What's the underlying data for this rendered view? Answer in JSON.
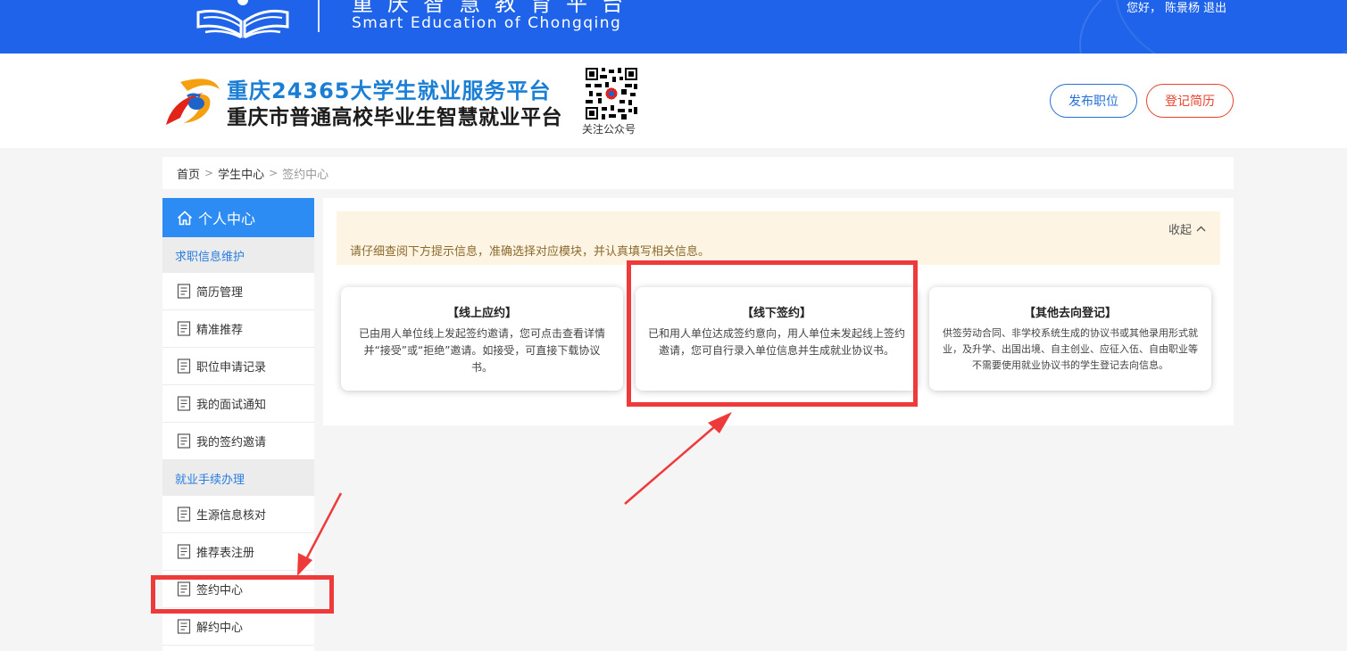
{
  "topbar": {
    "cn_title": "重庆智慧教育平台",
    "en_title": "Smart Education of Chongqing",
    "greeting": "您好，",
    "username": "陈景杨",
    "logout": "退出"
  },
  "header": {
    "brand_line1": "重庆24365大学生就业服务平台",
    "brand_line2": "重庆市普通高校毕业生智慧就业平台",
    "qr_caption": "关注公众号",
    "post_job": "发布职位",
    "register_resume": "登记简历"
  },
  "breadcrumb": {
    "home": "首页",
    "student_center": "学生中心",
    "current": "签约中心"
  },
  "sidebar": {
    "title": "个人中心",
    "group1": "求职信息维护",
    "group1_items": [
      {
        "label": "简历管理"
      },
      {
        "label": "精准推荐"
      },
      {
        "label": "职位申请记录"
      },
      {
        "label": "我的面试通知"
      },
      {
        "label": "我的签约邀请"
      }
    ],
    "group2": "就业手续办理",
    "group2_items": [
      {
        "label": "生源信息核对"
      },
      {
        "label": "推荐表注册"
      },
      {
        "label": "签约中心"
      },
      {
        "label": "解约中心"
      }
    ]
  },
  "notice": {
    "text": "请仔细查阅下方提示信息，准确选择对应模块，并认真填写相关信息。",
    "collapse": "收起"
  },
  "cards": [
    {
      "title": "【线上应约】",
      "desc": "已由用人单位线上发起签约邀请，您可点击查看详情并“接受”或“拒绝”邀请。如接受，可直接下载协议书。"
    },
    {
      "title": "【线下签约】",
      "desc": "已和用人单位达成签约意向，用人单位未发起线上签约邀请，您可自行录入单位信息并生成就业协议书。"
    },
    {
      "title": "【其他去向登记】",
      "desc": "供签劳动合同、非学校系统生成的协议书或其他录用形式就业，及升学、出国出境、自主创业、应征入伍、自由职业等不需要使用就业协议书的学生登记去向信息。"
    }
  ],
  "icons": {
    "logo": "book-logo-icon",
    "brand": "swirl-logo-icon",
    "home": "home-icon",
    "doc": "document-icon",
    "collapse": "chevron-up-icon"
  },
  "colors": {
    "primary_blue": "#1e63e9",
    "sidebar_blue": "#2c8cf4",
    "accent_red": "#e8432c",
    "annotation_red": "#ee3a3a",
    "notice_bg": "#fdf4e3"
  }
}
